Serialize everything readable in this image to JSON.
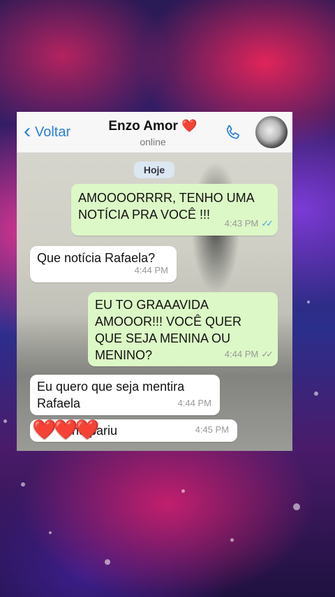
{
  "header": {
    "back_label": "Voltar",
    "contact_name": "Enzo Amor",
    "contact_emoji": "❤️",
    "status": "online"
  },
  "date_badge": "Hoje",
  "messages": [
    {
      "direction": "outgoing",
      "text": "AMOOOORRRR, TENHO UMA NOTÍCIA PRA VOCÊ !!!",
      "time": "4:43 PM",
      "read": true
    },
    {
      "direction": "incoming",
      "text": "Que notícia Rafaela?",
      "time": "4:44 PM"
    },
    {
      "direction": "outgoing",
      "text": "EU TO GRAAAVIDA AMOOOR!!! VOCÊ QUER QUE SEJA MENINA OU MENINO?",
      "time": "4:44 PM",
      "read": false
    },
    {
      "direction": "incoming",
      "text": "Eu quero que seja mentira Rafaela",
      "time": "4:44 PM"
    },
    {
      "direction": "incoming",
      "text": "ne pariu",
      "time": "4:45 PM"
    }
  ],
  "overlay_hearts": "❤️❤️❤️",
  "colors": {
    "accent": "#2a7fd6",
    "outgoing_bubble": "#dcf8c6",
    "incoming_bubble": "#ffffff",
    "read_ticks": "#4fa3e0"
  }
}
